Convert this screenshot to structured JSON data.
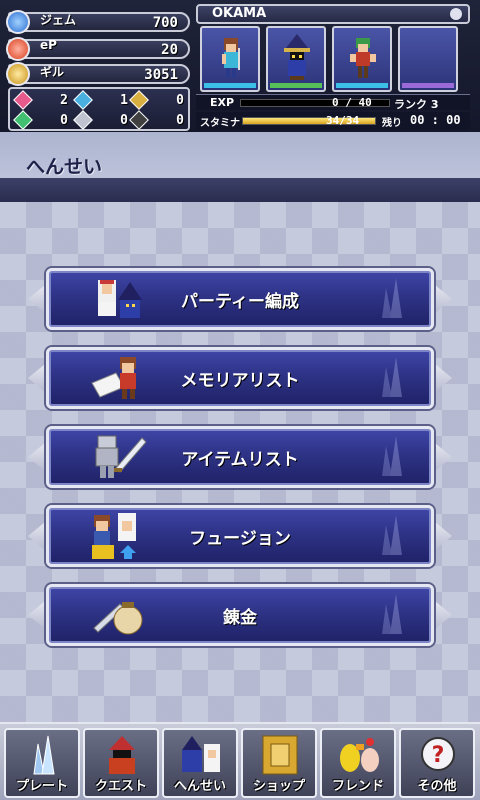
{
  "resources": {
    "gem": {
      "label": "ジェム",
      "value": "700"
    },
    "ep": {
      "label": "eP",
      "value": "20"
    },
    "gil": {
      "label": "ギル",
      "value": "3051"
    }
  },
  "crystals": {
    "pink": "2",
    "blue": "1",
    "gold": "0",
    "green": "0",
    "silver": "0",
    "black": "0"
  },
  "party": {
    "name": "OKAMA",
    "exp_label": "EXP",
    "exp_value": "0 / 40",
    "rank": "ランク 3",
    "stamina_label": "スタミナ",
    "stamina_value": "34/34",
    "stamina_fraction": 1.0,
    "exp_fraction": 0.0,
    "timer_label": "残り",
    "timer": "00 : 00"
  },
  "section": {
    "title": "へんせい"
  },
  "menu": [
    {
      "label": "パーティー編成"
    },
    {
      "label": "メモリアリスト"
    },
    {
      "label": "アイテムリスト"
    },
    {
      "label": "フュージョン"
    },
    {
      "label": "錬金"
    }
  ],
  "nav": [
    {
      "label": "プレート"
    },
    {
      "label": "クエスト"
    },
    {
      "label": "へんせい"
    },
    {
      "label": "ショップ"
    },
    {
      "label": "フレンド"
    },
    {
      "label": "その他"
    }
  ],
  "colors": {
    "menu_button": "#2e3386",
    "background": "#c6cadd",
    "stamina": "#f0c850"
  }
}
